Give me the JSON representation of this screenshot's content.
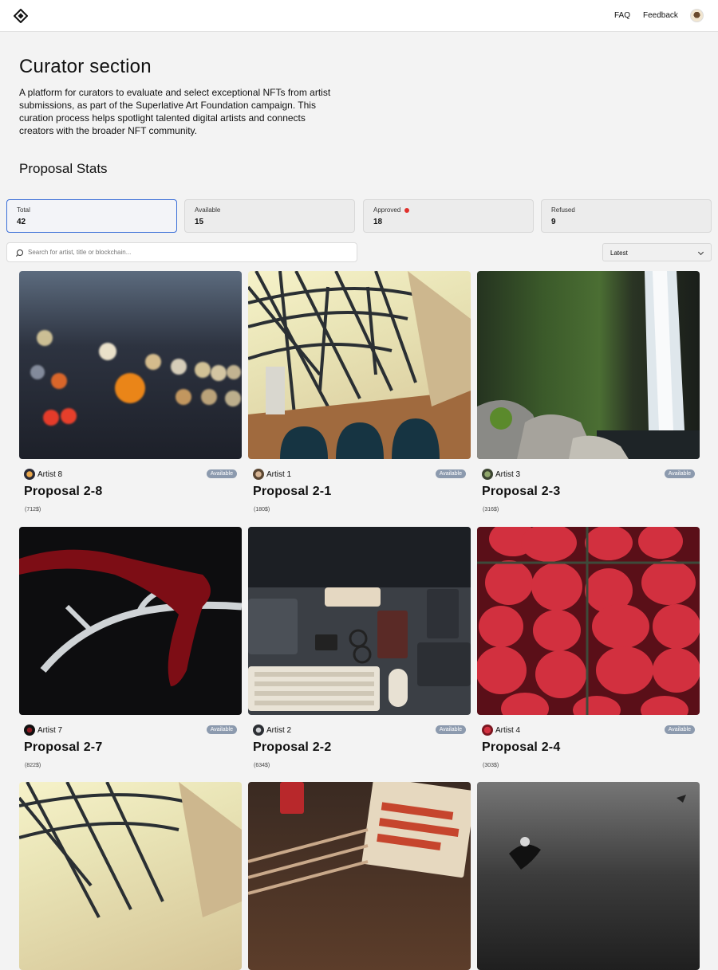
{
  "header": {
    "faq_label": "FAQ",
    "feedback_label": "Feedback"
  },
  "hero": {
    "title": "Curator section",
    "description": "A platform for curators to evaluate and select exceptional NFTs from artist submissions, as part of the Superlative Art Foundation campaign. This curation process helps spotlight talented digital artists and connects creators with the broader NFT community."
  },
  "stats": {
    "title": "Proposal Stats",
    "items": [
      {
        "label": "Total",
        "value": "42"
      },
      {
        "label": "Available",
        "value": "15"
      },
      {
        "label": "Approved",
        "value": "18"
      },
      {
        "label": "Refused",
        "value": "9"
      }
    ]
  },
  "search": {
    "placeholder": "Search for artist, title or blockchain..."
  },
  "sort": {
    "selected": "Latest"
  },
  "cards": [
    {
      "artist": "Artist 8",
      "status": "Available",
      "title": "Proposal 2-8",
      "price": "(712$)"
    },
    {
      "artist": "Artist 1",
      "status": "Available",
      "title": "Proposal 2-1",
      "price": "(180$)"
    },
    {
      "artist": "Artist 3",
      "status": "Available",
      "title": "Proposal 2-3",
      "price": "(316$)"
    },
    {
      "artist": "Artist 7",
      "status": "Available",
      "title": "Proposal 2-7",
      "price": "(822$)"
    },
    {
      "artist": "Artist 2",
      "status": "Available",
      "title": "Proposal 2-2",
      "price": "(634$)"
    },
    {
      "artist": "Artist 4",
      "status": "Available",
      "title": "Proposal 2-4",
      "price": "(303$)"
    }
  ],
  "colors": {
    "accent_border": "#3b6fd8",
    "badge_bg": "#8c9aae",
    "approved_dot": "#e0302b"
  }
}
